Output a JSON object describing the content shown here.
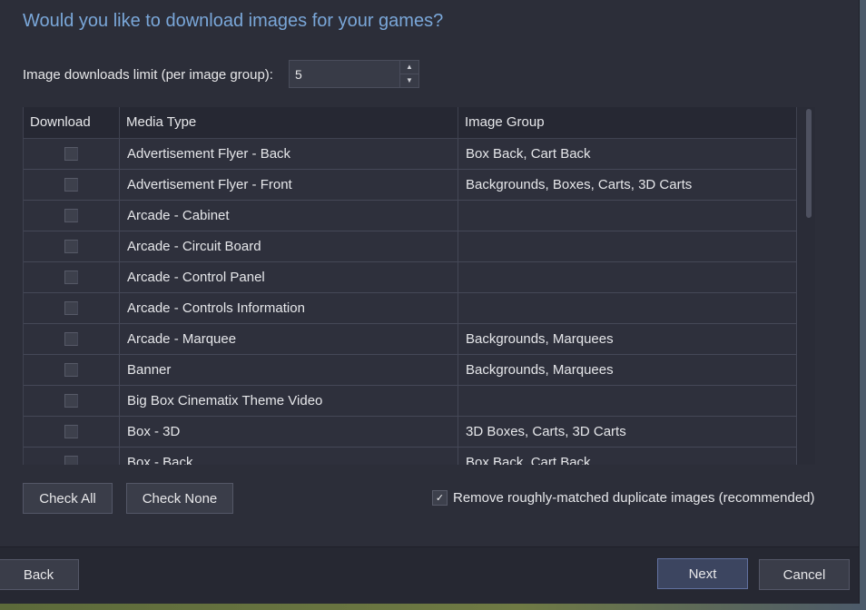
{
  "dialog": {
    "title": "Would you like to download images for your games?",
    "limit_label": "Image downloads limit (per image group):",
    "limit_value": "5"
  },
  "table": {
    "headers": [
      "Download",
      "Media Type",
      "Image Group"
    ],
    "rows": [
      {
        "checked": true,
        "media_type": "Advertisement Flyer - Back",
        "image_group": "Box Back, Cart Back"
      },
      {
        "checked": true,
        "media_type": "Advertisement Flyer - Front",
        "image_group": "Backgrounds, Boxes, Carts, 3D Carts"
      },
      {
        "checked": true,
        "media_type": "Arcade - Cabinet",
        "image_group": ""
      },
      {
        "checked": true,
        "media_type": "Arcade - Circuit Board",
        "image_group": ""
      },
      {
        "checked": true,
        "media_type": "Arcade - Control Panel",
        "image_group": ""
      },
      {
        "checked": true,
        "media_type": "Arcade - Controls Information",
        "image_group": ""
      },
      {
        "checked": true,
        "media_type": "Arcade - Marquee",
        "image_group": "Backgrounds, Marquees"
      },
      {
        "checked": true,
        "media_type": "Banner",
        "image_group": "Backgrounds, Marquees"
      },
      {
        "checked": false,
        "media_type": "Big Box Cinematix Theme Video",
        "image_group": ""
      },
      {
        "checked": true,
        "media_type": "Box - 3D",
        "image_group": "3D Boxes, Carts, 3D Carts"
      },
      {
        "checked": true,
        "media_type": "Box - Back",
        "image_group": "Box Back, Cart Back"
      }
    ]
  },
  "buttons": {
    "check_all": "Check All",
    "check_none": "Check None",
    "back": "Back",
    "next": "Next",
    "cancel": "Cancel"
  },
  "dedup": {
    "checked": true,
    "label": "Remove roughly-matched duplicate images (recommended)"
  },
  "glyphs": {
    "check": "✓",
    "up": "▲",
    "down": "▼"
  }
}
